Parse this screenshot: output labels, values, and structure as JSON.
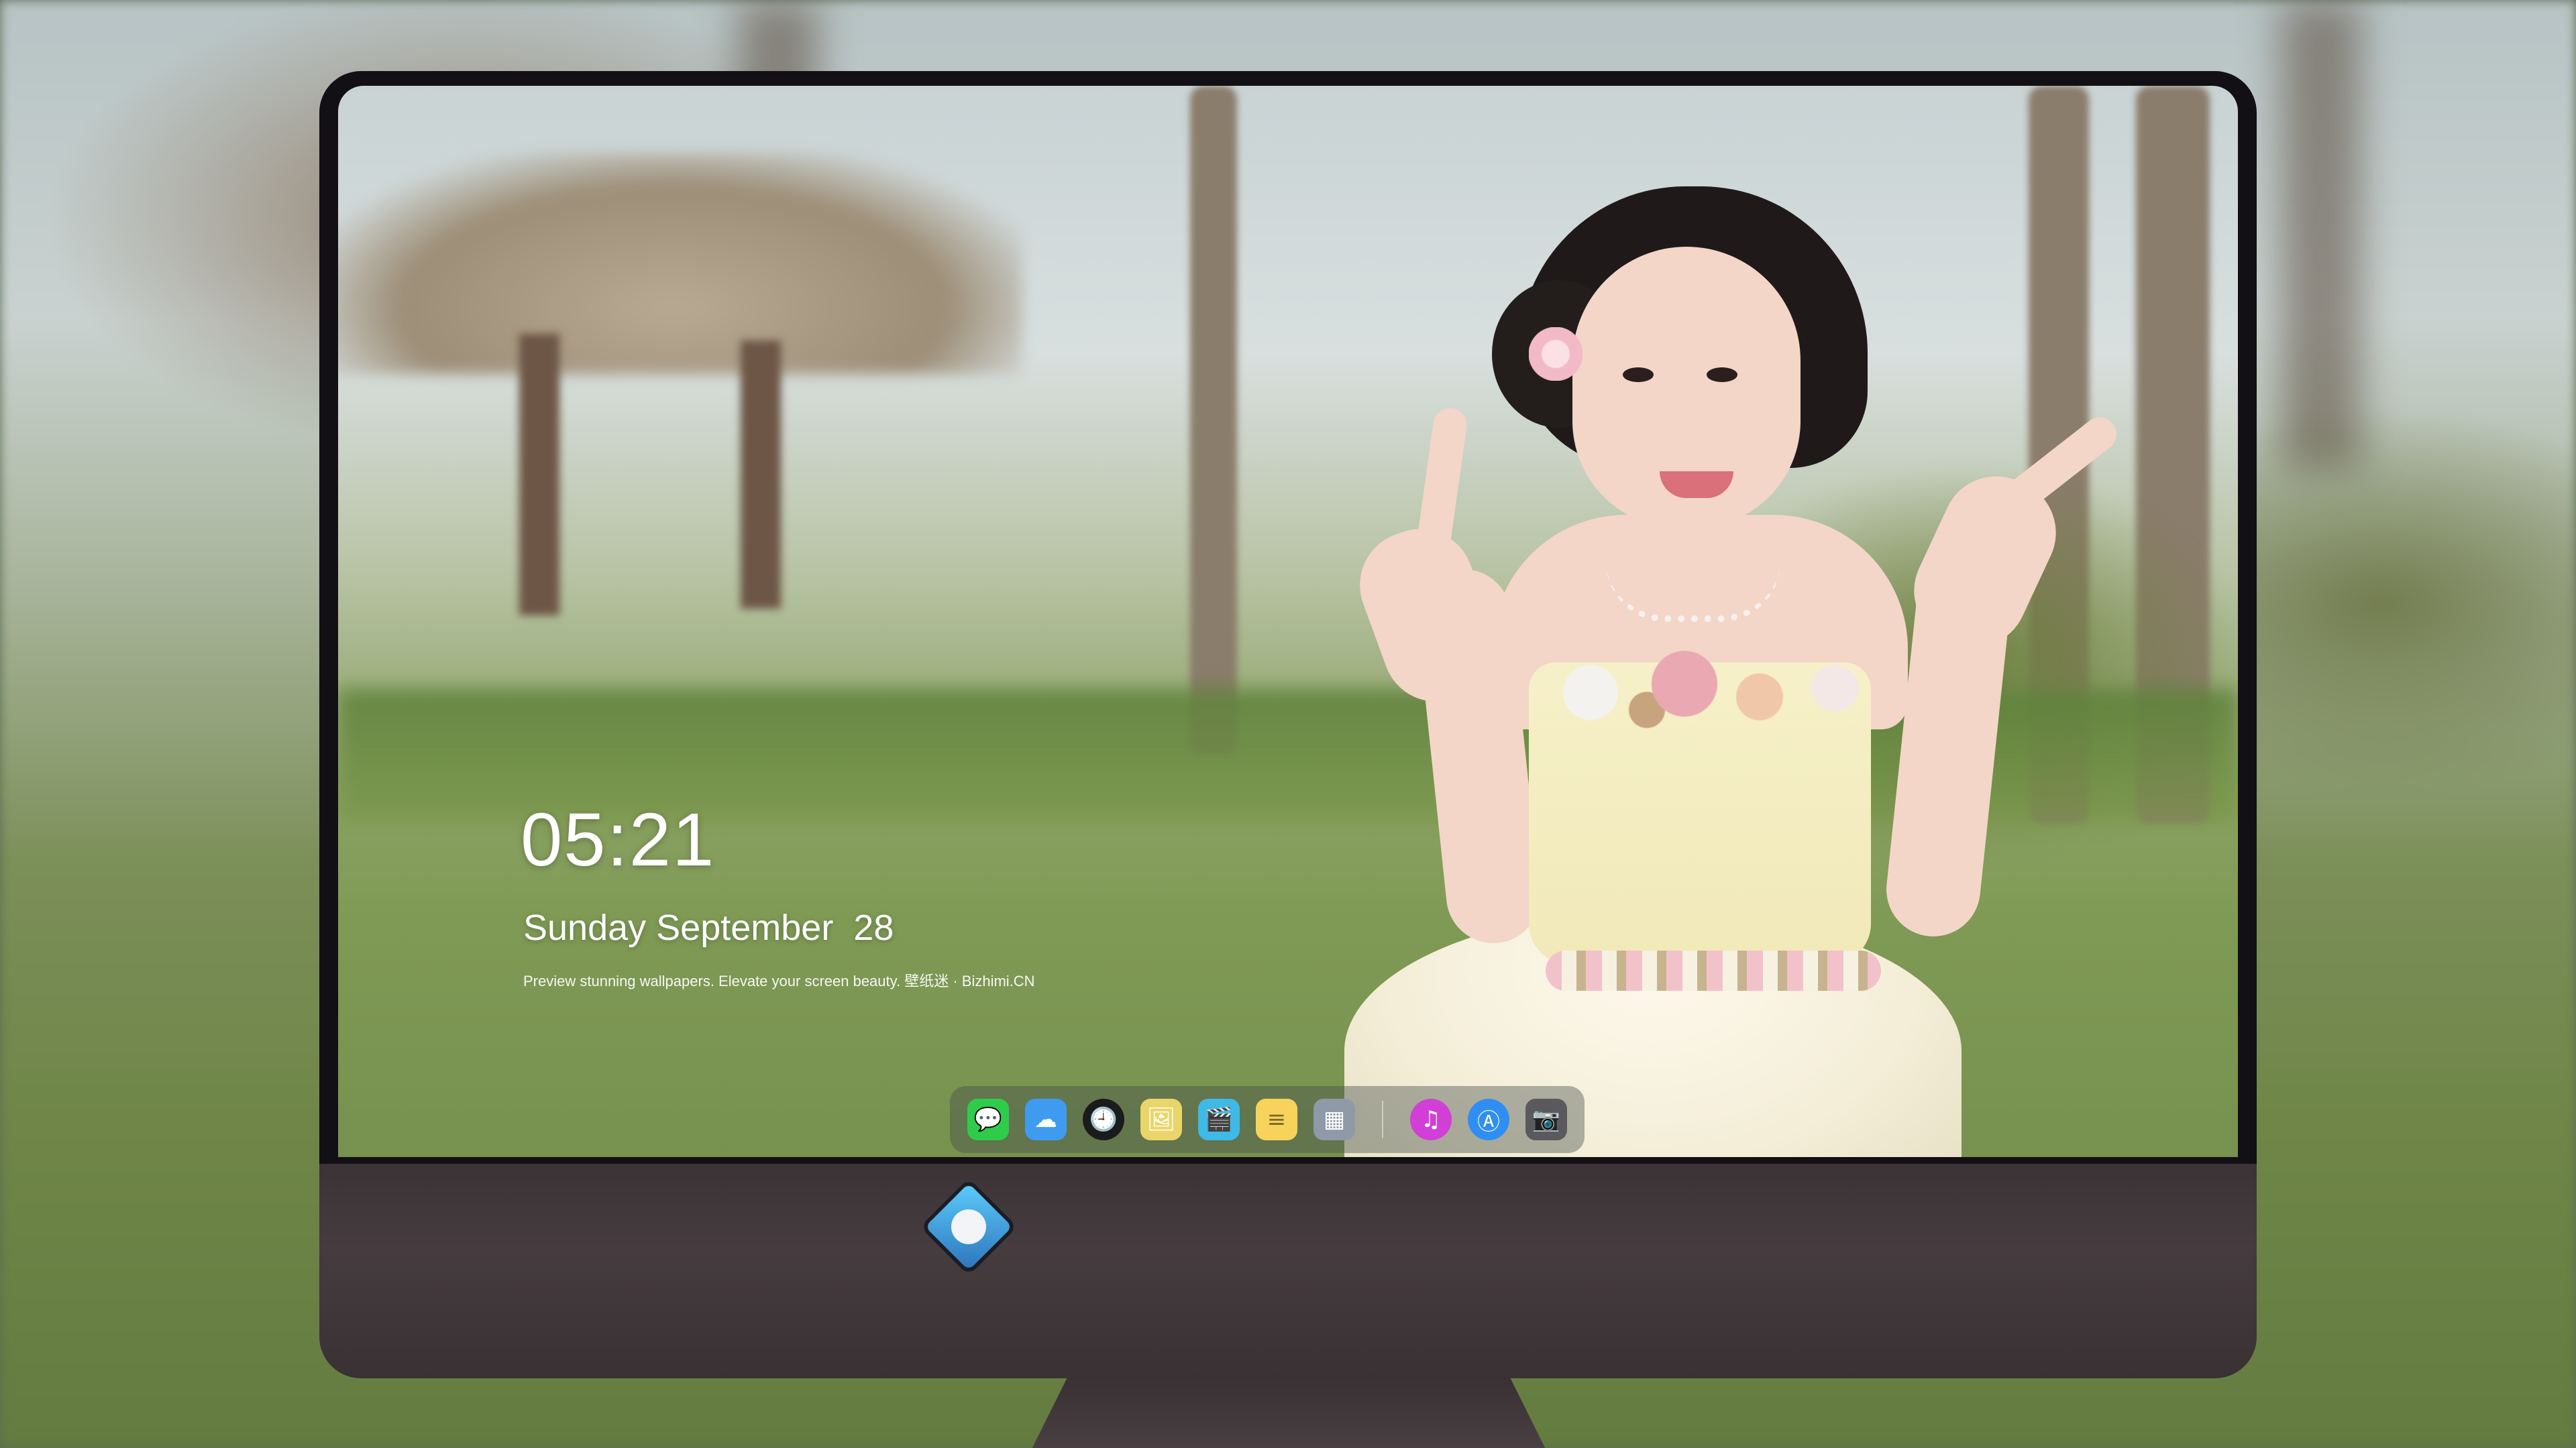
{
  "lock_screen": {
    "time": "05:21",
    "date": "Sunday September  28",
    "tagline": "Preview stunning wallpapers. Elevate your screen beauty. 壁纸迷 · Bizhimi.CN"
  },
  "dock": {
    "apps": [
      {
        "name": "Messages",
        "icon": "messages-icon",
        "glyph": "💬",
        "color": "#2ecc4a"
      },
      {
        "name": "Weather",
        "icon": "weather-icon",
        "glyph": "☁",
        "color": "#3f9bf0"
      },
      {
        "name": "Clock",
        "icon": "clock-icon",
        "glyph": "🕘",
        "color": "#1b1b1b"
      },
      {
        "name": "Preview",
        "icon": "preview-icon",
        "glyph": "🖼",
        "color": "#e9d56a"
      },
      {
        "name": "Clips",
        "icon": "clips-icon",
        "glyph": "🎬",
        "color": "#3fb9e6"
      },
      {
        "name": "Notes",
        "icon": "notes-icon",
        "glyph": "≡",
        "color": "#f7d35c"
      },
      {
        "name": "Photo Booth",
        "icon": "photo-booth-icon",
        "glyph": "▦",
        "color": "#8e9aa8"
      },
      {
        "name": "iTunes",
        "icon": "itunes-icon",
        "glyph": "♫",
        "color": "#d23fd6"
      },
      {
        "name": "App Store",
        "icon": "app-store-icon",
        "glyph": "Ⓐ",
        "color": "#2f8ef3"
      },
      {
        "name": "Camera",
        "icon": "camera-icon",
        "glyph": "📷",
        "color": "#5a5a5e"
      }
    ]
  },
  "colors": {
    "bezel": "#121014",
    "chin": "#463c3f",
    "dock_bg": "rgba(70,78,74,0.42)",
    "logo_accent": "#5fd1ff"
  }
}
